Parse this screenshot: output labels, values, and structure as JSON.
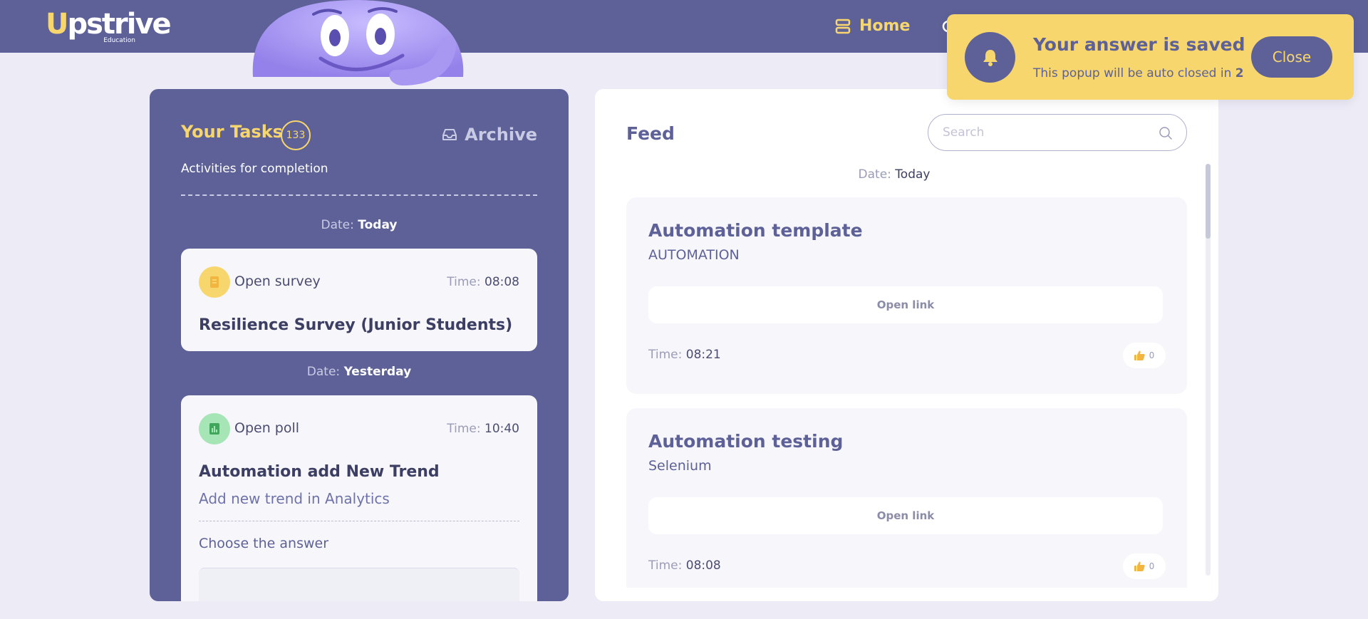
{
  "header": {
    "logo_text": "Upstrive",
    "logo_sub": "Education",
    "nav_home_label": "Home"
  },
  "tasks": {
    "title": "Your Tasks",
    "count": "133",
    "archive_label": "Archive",
    "subtitle": "Activities for completion",
    "date_label": "Date:",
    "groups": [
      {
        "date": "Today",
        "card": {
          "type": "Open survey",
          "time_label": "Time:",
          "time": "08:08",
          "title": "Resilience Survey (Junior Students)"
        }
      },
      {
        "date": "Yesterday",
        "card": {
          "type": "Open poll",
          "time_label": "Time:",
          "time": "10:40",
          "title": "Automation add New Trend",
          "description": "Add new trend in Analytics",
          "answer_prompt": "Choose the answer"
        }
      }
    ]
  },
  "feed": {
    "title": "Feed",
    "search_placeholder": "Search",
    "date_label": "Date:",
    "date_value": "Today",
    "open_link_label": "Open link",
    "time_label": "Time:",
    "items": [
      {
        "title": "Automation template",
        "subtitle": "AUTOMATION",
        "time": "08:21",
        "likes": "0"
      },
      {
        "title": "Automation testing",
        "subtitle": "Selenium",
        "time": "08:08",
        "likes": "0"
      }
    ]
  },
  "toast": {
    "title": "Your answer is saved",
    "message": "This popup will be auto closed in",
    "countdown": "2",
    "close_label": "Close"
  },
  "colors": {
    "primary": "#5d6198",
    "accent": "#f7d66e",
    "background": "#ecebf6",
    "mascot": "#a99af0"
  },
  "icons": {
    "nav_home": "home-icon",
    "archive": "inbox-icon",
    "survey": "survey-document-icon",
    "poll": "poll-chart-icon",
    "search": "search-icon",
    "like": "thumbs-up-icon",
    "toast": "bell-icon"
  }
}
